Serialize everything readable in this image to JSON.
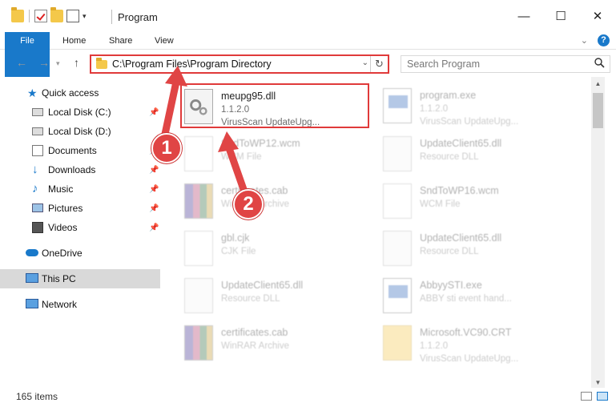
{
  "window": {
    "title": "Program",
    "minimize": "—",
    "maximize": "☐",
    "close": "✕"
  },
  "ribbon": {
    "tabs": [
      "File",
      "Home",
      "Share",
      "View"
    ]
  },
  "nav": {
    "back": "←",
    "forward": "→",
    "up": "↑",
    "address": "C:\\Program Files\\Program Directory",
    "search_placeholder": "Search Program"
  },
  "sidebar": {
    "items": [
      {
        "label": "Quick access",
        "icon": "star-icon",
        "pinned": false
      },
      {
        "label": "Local Disk (C:)",
        "icon": "drive-icon",
        "pinned": true
      },
      {
        "label": "Local Disk (D:)",
        "icon": "drive-icon",
        "pinned": false
      },
      {
        "label": "Documents",
        "icon": "documents-icon",
        "pinned": true
      },
      {
        "label": "Downloads",
        "icon": "downloads-icon",
        "pinned": true
      },
      {
        "label": "Music",
        "icon": "music-icon",
        "pinned": true
      },
      {
        "label": "Pictures",
        "icon": "pictures-icon",
        "pinned": true
      },
      {
        "label": "Videos",
        "icon": "videos-icon",
        "pinned": true
      },
      {
        "label": "OneDrive",
        "icon": "cloud-icon",
        "pinned": false
      },
      {
        "label": "This PC",
        "icon": "computer-icon",
        "pinned": false,
        "selected": true
      },
      {
        "label": "Network",
        "icon": "network-icon",
        "pinned": false
      }
    ]
  },
  "files": [
    {
      "name": "meupg95.dll",
      "meta1": "1.1.2.0",
      "meta2": "VirusScan UpdateUpg...",
      "icon": "gear-doc-icon",
      "highlighted": true
    },
    {
      "name": "program.exe",
      "meta1": "1.1.2.0",
      "meta2": "VirusScan UpdateUpg...",
      "icon": "exe-icon"
    },
    {
      "name": "SndToWP12.wcm",
      "meta1": "WCM File",
      "meta2": "",
      "icon": "doc-icon"
    },
    {
      "name": "UpdateClient65.dll",
      "meta1": "Resource DLL",
      "meta2": "",
      "icon": "gear-doc-icon"
    },
    {
      "name": "certificates.cab",
      "meta1": "WinRAR Archive",
      "meta2": "",
      "icon": "rar-icon"
    },
    {
      "name": "SndToWP16.wcm",
      "meta1": "WCM File",
      "meta2": "",
      "icon": "doc-icon"
    },
    {
      "name": "gbl.cjk",
      "meta1": "CJK File",
      "meta2": "",
      "icon": "doc-icon"
    },
    {
      "name": "UpdateClient65.dll",
      "meta1": "Resource DLL",
      "meta2": "",
      "icon": "gear-doc-icon"
    },
    {
      "name": "UpdateClient65.dll",
      "meta1": "Resource DLL",
      "meta2": "",
      "icon": "gear-doc-icon"
    },
    {
      "name": "AbbyySTI.exe",
      "meta1": "ABBY sti event hand...",
      "meta2": "",
      "icon": "exe-icon"
    },
    {
      "name": "certificates.cab",
      "meta1": "WinRAR Archive",
      "meta2": "",
      "icon": "rar-icon"
    },
    {
      "name": "Microsoft.VC90.CRT",
      "meta1": "1.1.2.0",
      "meta2": "VirusScan UpdateUpg...",
      "icon": "folder-doc-icon"
    }
  ],
  "status": {
    "item_count": "165 items"
  },
  "callouts": {
    "one": "1",
    "two": "2"
  },
  "colors": {
    "accent": "#1979ca",
    "annotation": "#e03a3a"
  }
}
